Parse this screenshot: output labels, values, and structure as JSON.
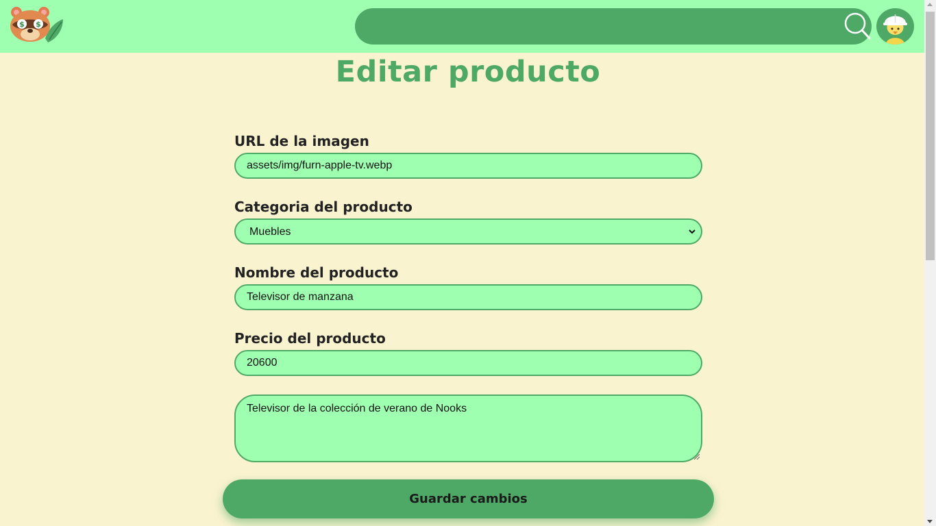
{
  "header": {
    "logo_name": "tom-nook-logo",
    "search_placeholder": "",
    "search_icon": "search-icon",
    "avatar_icon": "user-avatar"
  },
  "page": {
    "title": "Editar producto"
  },
  "form": {
    "image_url": {
      "label": "URL de la imagen",
      "value": "assets/img/furn-apple-tv.webp"
    },
    "category": {
      "label": "Categoria del producto",
      "value": "Muebles"
    },
    "name": {
      "label": "Nombre del producto",
      "value": "Televisor de manzana"
    },
    "price": {
      "label": "Precio del producto",
      "value": "20600"
    },
    "description": {
      "value": "Televisor de la colección de verano de Nooks"
    },
    "save_label": "Guardar cambios"
  },
  "colors": {
    "header_bg": "#9effb0",
    "accent": "#4ea966",
    "page_bg": "#faf3d0"
  }
}
